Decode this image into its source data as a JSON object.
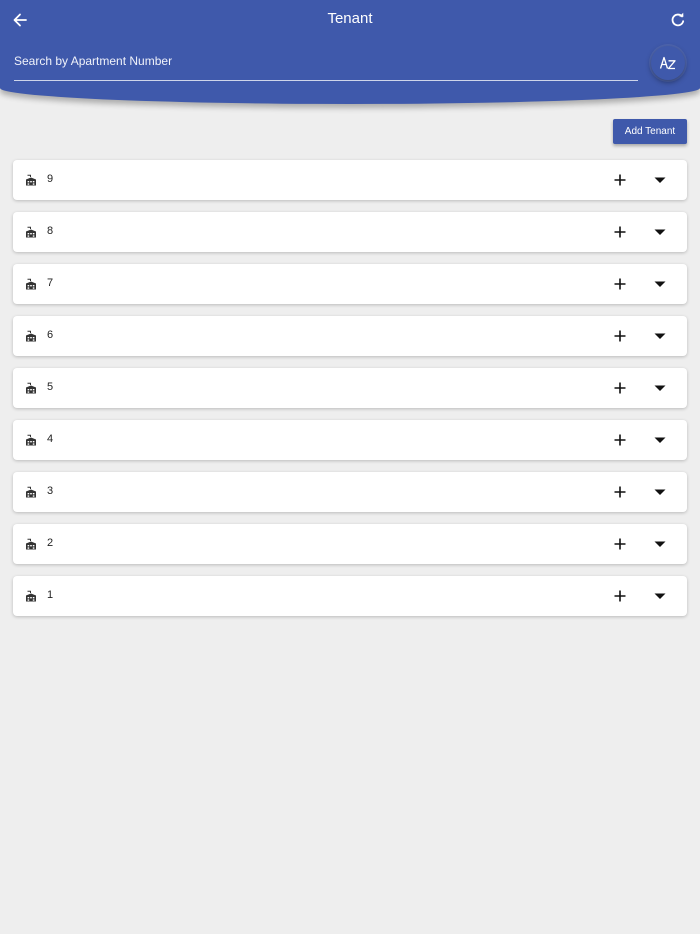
{
  "header": {
    "title": "Tenant",
    "back_icon": "arrow-left-icon",
    "refresh_icon": "refresh-icon",
    "sort_icon": "sort-alpha-icon"
  },
  "search": {
    "placeholder": "Search by Apartment Number",
    "value": ""
  },
  "actions": {
    "add_tenant_label": "Add Tenant"
  },
  "apartments": [
    {
      "number": "9"
    },
    {
      "number": "8"
    },
    {
      "number": "7"
    },
    {
      "number": "6"
    },
    {
      "number": "5"
    },
    {
      "number": "4"
    },
    {
      "number": "3"
    },
    {
      "number": "2"
    },
    {
      "number": "1"
    }
  ],
  "colors": {
    "primary": "#3f59ab",
    "background": "#eeeeee",
    "card": "#ffffff"
  }
}
